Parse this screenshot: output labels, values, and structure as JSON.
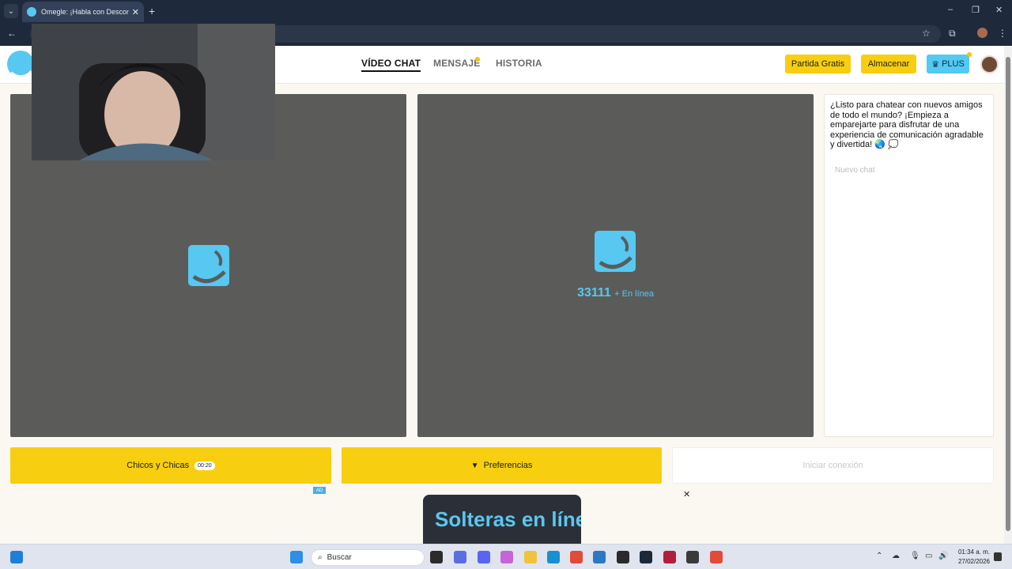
{
  "browser": {
    "tab_title": "Omegle: ¡Habla con Desconocidos!",
    "tab_close": "✕",
    "new_tab": "+",
    "window_controls": [
      "–",
      "❐",
      "✕"
    ]
  },
  "header": {
    "nav": [
      {
        "label": "VÍDEO CHAT",
        "active": true
      },
      {
        "label": "MENSAJE",
        "has_dot": true
      },
      {
        "label": "HISTORIA"
      }
    ],
    "buttons": {
      "free_match": "Partida Gratis",
      "store": "Almacenar",
      "plus": "PLUS",
      "plus_icon": "♛"
    }
  },
  "main": {
    "online_count": "33111",
    "online_label": "+ En línea",
    "chat_intro": "¿Listo para chatear con nuevos amigos de todo el mundo? ¡Empieza a emparejarte para disfrutar de una experiencia de comunicación agradable y divertida! 🌏 💭",
    "chat_placeholder": "Nuevo chat"
  },
  "actions": {
    "gender_label": "Chicos y Chicas",
    "gender_timer": "00:20",
    "preferences_label": "Preferencias",
    "preferences_icon": "▼",
    "start_label": "Iniciar conexión"
  },
  "ad": {
    "badge": "AD",
    "close": "✕",
    "headline": "Solteras en línea"
  },
  "taskbar": {
    "search_placeholder": "Buscar",
    "time": "01:34 a. m.",
    "date": "27/02/2026"
  },
  "colors": {
    "brand_yellow": "#f7cf10",
    "brand_blue": "#56c8f2",
    "panel_gray": "#5b5c5a"
  }
}
